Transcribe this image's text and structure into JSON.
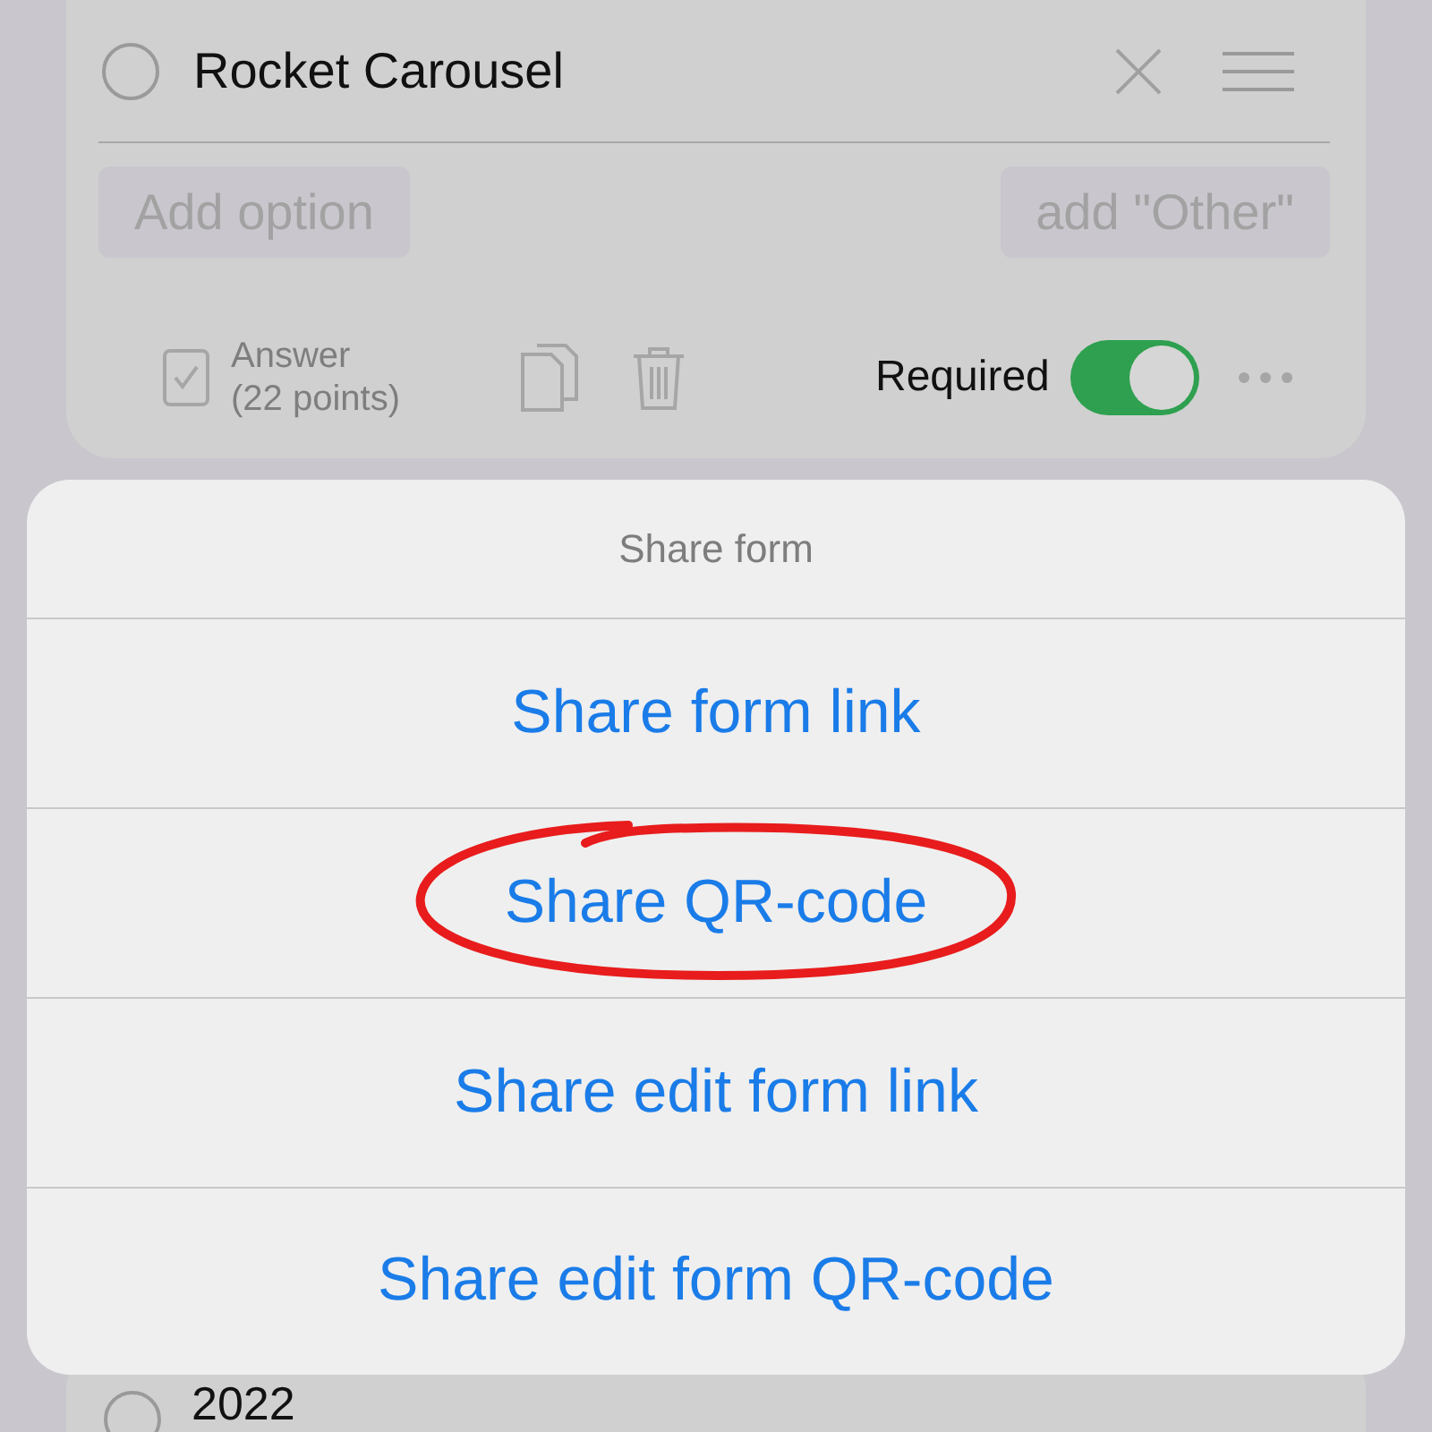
{
  "question_card": {
    "option": {
      "label": "Rocket Carousel",
      "selected": false
    },
    "add_option": "Add option",
    "add_other": "add \"Other\"",
    "answer": {
      "label": "Answer",
      "points": "(22 points)",
      "checked": true
    },
    "required": {
      "label": "Required",
      "on": true
    }
  },
  "share_sheet": {
    "title": "Share form",
    "actions": [
      {
        "label": "Share form link",
        "highlighted": false
      },
      {
        "label": "Share QR-code",
        "highlighted": true
      },
      {
        "label": "Share edit form link",
        "highlighted": false
      },
      {
        "label": "Share edit form QR-code",
        "highlighted": false
      }
    ]
  },
  "next_option": {
    "label": "2022",
    "selected": false
  }
}
